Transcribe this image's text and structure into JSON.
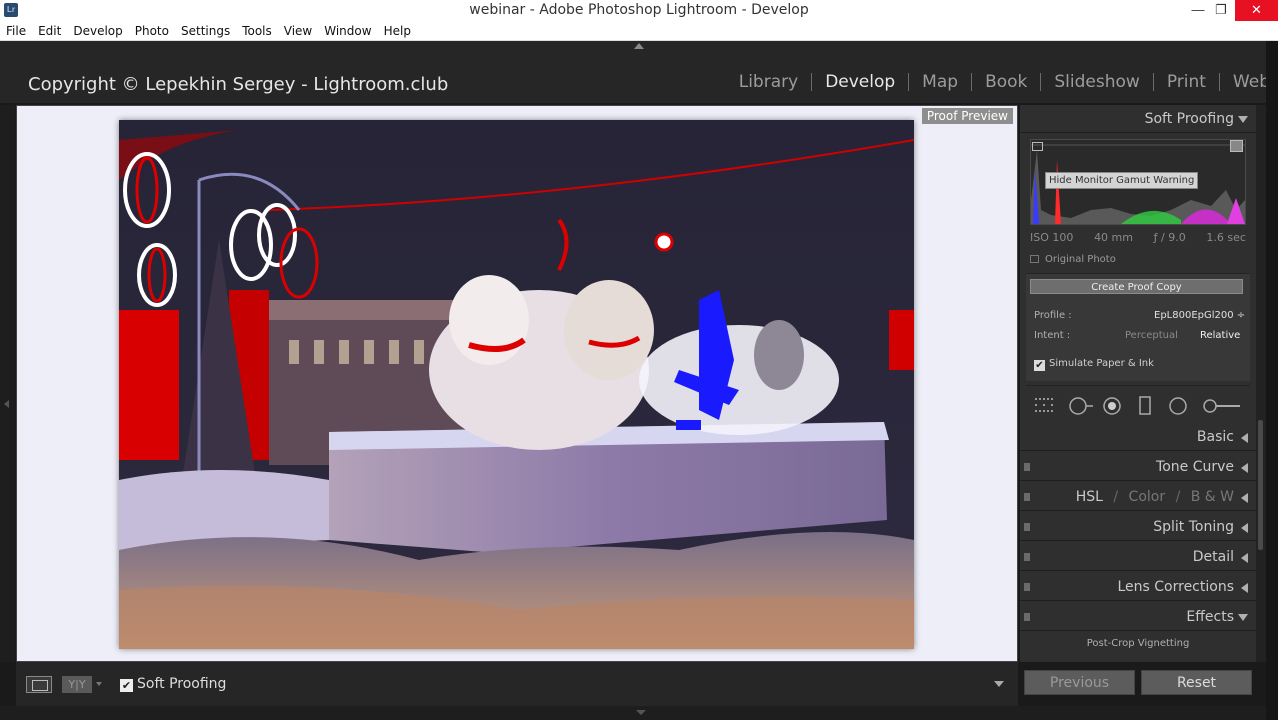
{
  "window": {
    "title": "webinar - Adobe Photoshop Lightroom - Develop",
    "app_icon": "Lr",
    "controls": {
      "minimize": "—",
      "maximize": "❐",
      "close": "✕"
    }
  },
  "menu": [
    "File",
    "Edit",
    "Develop",
    "Photo",
    "Settings",
    "Tools",
    "View",
    "Window",
    "Help"
  ],
  "header": {
    "identity_plate": "Copyright © Lepekhin Sergey - Lightroom.club",
    "modules": [
      "Library",
      "Develop",
      "Map",
      "Book",
      "Slideshow",
      "Print",
      "Web"
    ],
    "active_module": "Develop"
  },
  "view": {
    "proof_label": "Proof Preview"
  },
  "right_panel": {
    "soft_proofing_header": "Soft Proofing",
    "histogram_tooltip": "Hide Monitor Gamut Warning",
    "exif": {
      "iso": "ISO 100",
      "focal": "40 mm",
      "aperture": "ƒ / 9.0",
      "shutter": "1.6 sec"
    },
    "original_photo": "Original Photo",
    "create_proof_copy": "Create Proof Copy",
    "profile_label": "Profile :",
    "profile_value": "EpL800EpGl200 ÷",
    "intent_label": "Intent :",
    "intent_perceptual": "Perceptual",
    "intent_relative": "Relative",
    "simulate_paper_ink": "Simulate Paper & Ink",
    "panels": {
      "basic": "Basic",
      "tone_curve": "Tone Curve",
      "hsl": "HSL",
      "color": "Color",
      "bw": "B & W",
      "hsl_sep": "/",
      "split_toning": "Split Toning",
      "detail": "Detail",
      "lens_corrections": "Lens Corrections",
      "effects": "Effects"
    },
    "post_crop_vignetting": "Post-Crop Vignetting"
  },
  "toolbar": {
    "yy_label": "Y|Y",
    "soft_proofing_label": "Soft Proofing",
    "soft_proofing_checked": true
  },
  "buttons": {
    "previous": "Previous",
    "reset": "Reset"
  },
  "colors": {
    "gamut_warning_red": "#ff0000",
    "gamut_warning_blue": "#1a1aff",
    "panel_bg": "#2f2f2f",
    "close_red": "#e81123"
  }
}
